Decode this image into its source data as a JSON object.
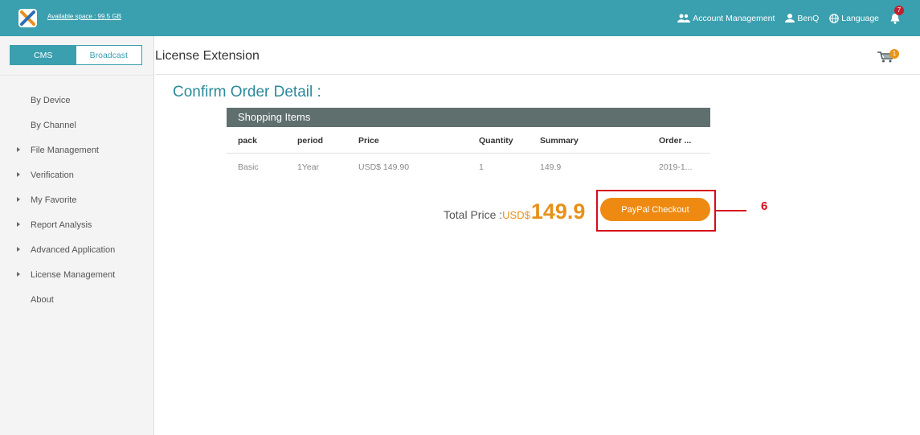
{
  "header": {
    "available_space": "Available space : 99.5 GB",
    "account_management": "Account Management",
    "user": "BenQ",
    "language": "Language",
    "notification_count": "7",
    "icons": {
      "logo": "x-logo-icon",
      "account": "users-icon",
      "user": "user-icon",
      "language": "globe-icon",
      "bell": "bell-icon"
    }
  },
  "sidebar": {
    "tabs": [
      {
        "label": "CMS",
        "active": true
      },
      {
        "label": "Broadcast",
        "active": false
      }
    ],
    "items": [
      {
        "label": "By Device",
        "expandable": false
      },
      {
        "label": "By Channel",
        "expandable": false
      },
      {
        "label": "File Management",
        "expandable": true
      },
      {
        "label": "Verification",
        "expandable": true
      },
      {
        "label": "My Favorite",
        "expandable": true
      },
      {
        "label": "Report Analysis",
        "expandable": true
      },
      {
        "label": "Advanced Application",
        "expandable": true
      },
      {
        "label": "License Management",
        "expandable": true
      },
      {
        "label": "About",
        "expandable": false
      }
    ]
  },
  "page": {
    "title": "License Extension",
    "cart_count": "1",
    "section_title": "Confirm Order Detail :",
    "items_header": "Shopping Items",
    "columns": [
      "pack",
      "period",
      "Price",
      "Quantity",
      "Summary",
      "Order ..."
    ],
    "rows": [
      [
        "Basic",
        "1Year",
        "USD$ 149.90",
        "1",
        "149.9",
        "2019-1..."
      ]
    ],
    "total_label": "Total Price :",
    "total_currency": "USD$",
    "total_amount": "149.9",
    "checkout_label": "PayPal Checkout",
    "callout_number": "6"
  },
  "colors": {
    "teal": "#3a9fae",
    "orange": "#ee8a12",
    "highlight": "#d60d1a"
  }
}
